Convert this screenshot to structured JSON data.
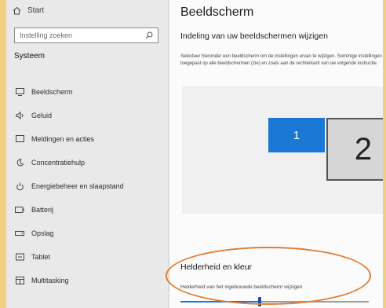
{
  "sidebar": {
    "home_label": "Start",
    "search_placeholder": "Instelling zoeken",
    "section_title": "Systeem",
    "items": [
      {
        "label": "Beeldscherm",
        "icon": "monitor-icon"
      },
      {
        "label": "Geluid",
        "icon": "speaker-icon"
      },
      {
        "label": "Meldingen en acties",
        "icon": "notifications-icon"
      },
      {
        "label": "Concentratiehulp",
        "icon": "moon-icon"
      },
      {
        "label": "Energiebeheer en slaapstand",
        "icon": "power-icon"
      },
      {
        "label": "Batterij",
        "icon": "battery-icon"
      },
      {
        "label": "Opslag",
        "icon": "storage-icon"
      },
      {
        "label": "Tablet",
        "icon": "tablet-icon"
      },
      {
        "label": "Multitasking",
        "icon": "multitasking-icon"
      }
    ]
  },
  "main": {
    "title": "Beeldscherm",
    "subtitle": "Indeling van uw beeldschermen wijzigen",
    "description_lines": [
      "Selecteer hieronder een beeldscherm om de instellingen ervan te wijzigen. Sommige instellingen worden",
      "toegepast op alle beeldschermen (zie) en zoals aan de rechterkant van uw volgende instructie."
    ],
    "monitors": [
      {
        "label": "1",
        "selected": true
      },
      {
        "label": "2",
        "selected": false
      }
    ],
    "brightness": {
      "title": "Helderheid en kleur",
      "description": "Helderheid van het ingebouwde beeldscherm wijzigen",
      "level": 0.42
    }
  },
  "colors": {
    "accent": "#1a77d4",
    "highlight_ring": "#e07d33",
    "frame": "#f3d488"
  }
}
